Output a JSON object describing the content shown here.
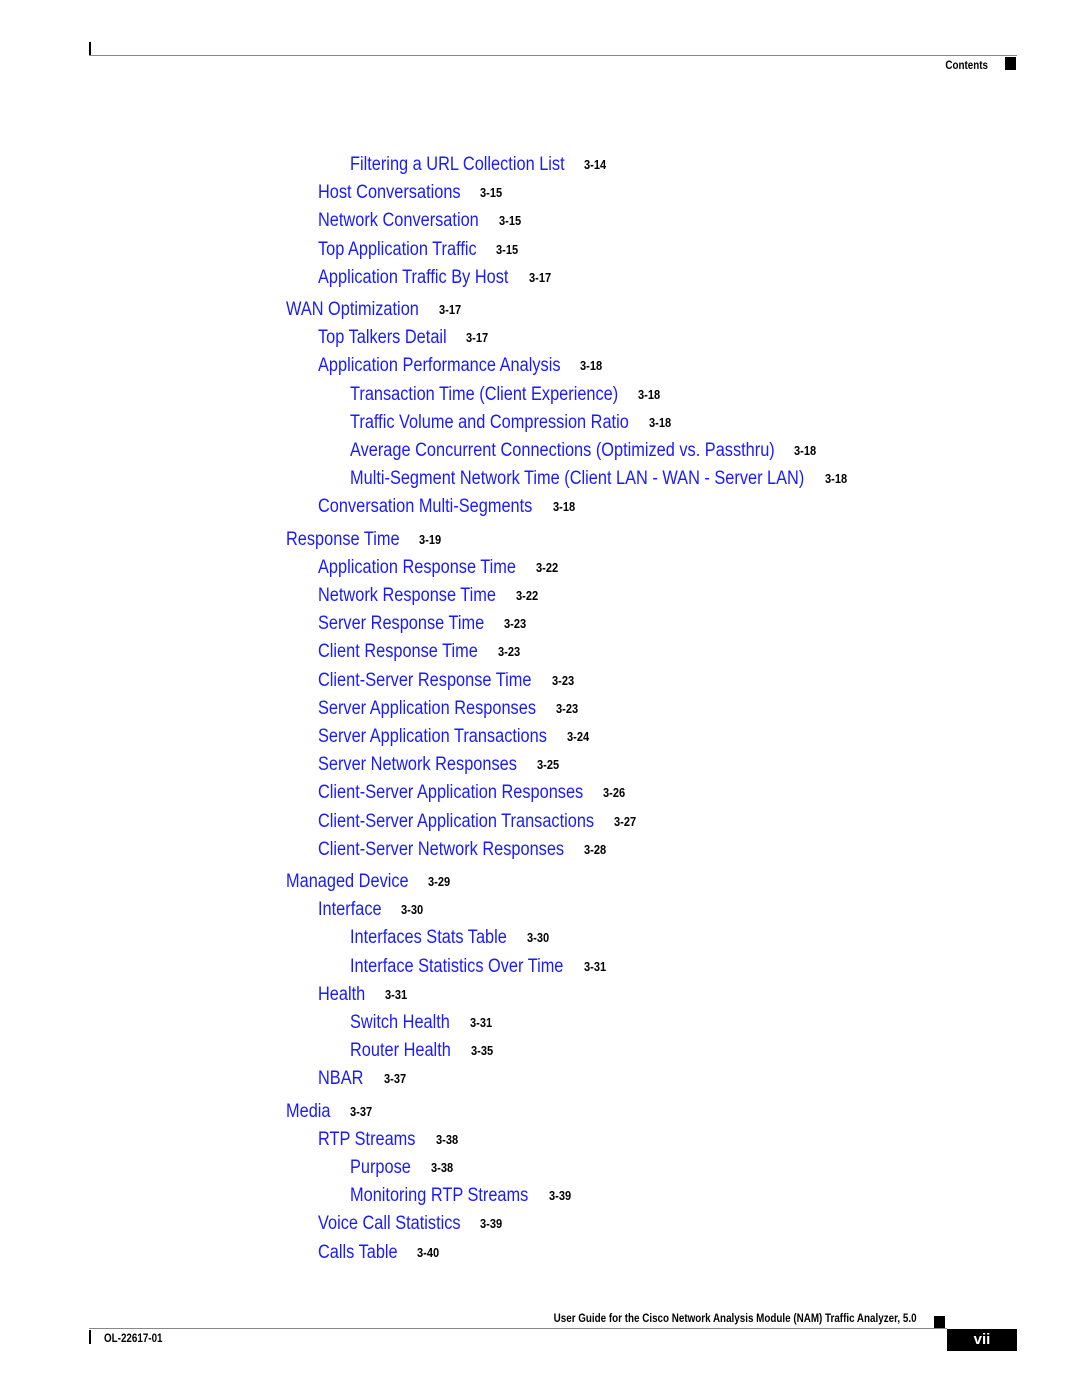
{
  "header": {
    "section_label": "Contents"
  },
  "toc": [
    {
      "level": 3,
      "title": "Filtering a URL Collection List",
      "page": "3-14"
    },
    {
      "level": 2,
      "title": "Host Conversations",
      "page": "3-15"
    },
    {
      "level": 2,
      "title": "Network Conversation",
      "page": "3-15"
    },
    {
      "level": 2,
      "title": "Top Application Traffic",
      "page": "3-15"
    },
    {
      "level": 2,
      "title": "Application Traffic By Host",
      "page": "3-17"
    },
    {
      "level": 1,
      "title": "WAN Optimization",
      "page": "3-17"
    },
    {
      "level": 2,
      "title": "Top Talkers Detail",
      "page": "3-17"
    },
    {
      "level": 2,
      "title": "Application Performance Analysis",
      "page": "3-18"
    },
    {
      "level": 3,
      "title": "Transaction Time (Client Experience)",
      "page": "3-18"
    },
    {
      "level": 3,
      "title": "Traffic Volume and Compression Ratio",
      "page": "3-18"
    },
    {
      "level": 3,
      "title": "Average Concurrent Connections (Optimized vs. Passthru)",
      "page": "3-18"
    },
    {
      "level": 3,
      "title": "Multi-Segment Network Time (Client LAN - WAN - Server LAN)",
      "page": "3-18"
    },
    {
      "level": 2,
      "title": "Conversation Multi-Segments",
      "page": "3-18"
    },
    {
      "level": 1,
      "title": "Response Time",
      "page": "3-19"
    },
    {
      "level": 2,
      "title": "Application Response Time",
      "page": "3-22"
    },
    {
      "level": 2,
      "title": "Network Response Time",
      "page": "3-22"
    },
    {
      "level": 2,
      "title": "Server Response Time",
      "page": "3-23"
    },
    {
      "level": 2,
      "title": "Client Response Time",
      "page": "3-23"
    },
    {
      "level": 2,
      "title": "Client-Server Response Time",
      "page": "3-23"
    },
    {
      "level": 2,
      "title": "Server Application Responses",
      "page": "3-23"
    },
    {
      "level": 2,
      "title": "Server Application Transactions",
      "page": "3-24"
    },
    {
      "level": 2,
      "title": "Server Network Responses",
      "page": "3-25"
    },
    {
      "level": 2,
      "title": "Client-Server Application Responses",
      "page": "3-26"
    },
    {
      "level": 2,
      "title": "Client-Server Application Transactions",
      "page": "3-27"
    },
    {
      "level": 2,
      "title": "Client-Server Network Responses",
      "page": "3-28"
    },
    {
      "level": 1,
      "title": "Managed Device",
      "page": "3-29"
    },
    {
      "level": 2,
      "title": "Interface",
      "page": "3-30"
    },
    {
      "level": 3,
      "title": "Interfaces Stats Table",
      "page": "3-30"
    },
    {
      "level": 3,
      "title": "Interface Statistics Over Time",
      "page": "3-31"
    },
    {
      "level": 2,
      "title": "Health",
      "page": "3-31"
    },
    {
      "level": 3,
      "title": "Switch Health",
      "page": "3-31"
    },
    {
      "level": 3,
      "title": "Router Health",
      "page": "3-35"
    },
    {
      "level": 2,
      "title": "NBAR",
      "page": "3-37"
    },
    {
      "level": 1,
      "title": "Media",
      "page": "3-37"
    },
    {
      "level": 2,
      "title": "RTP Streams",
      "page": "3-38"
    },
    {
      "level": 3,
      "title": "Purpose",
      "page": "3-38"
    },
    {
      "level": 3,
      "title": "Monitoring RTP Streams",
      "page": "3-39"
    },
    {
      "level": 2,
      "title": "Voice Call Statistics",
      "page": "3-39"
    },
    {
      "level": 2,
      "title": "Calls Table",
      "page": "3-40"
    }
  ],
  "footer": {
    "guide_title": "User Guide for the Cisco Network Analysis Module (NAM) Traffic Analyzer, 5.0",
    "doc_number": "OL-22617-01",
    "page_number": "vii"
  },
  "colors": {
    "link": "#1a1aff",
    "text": "#000000"
  }
}
